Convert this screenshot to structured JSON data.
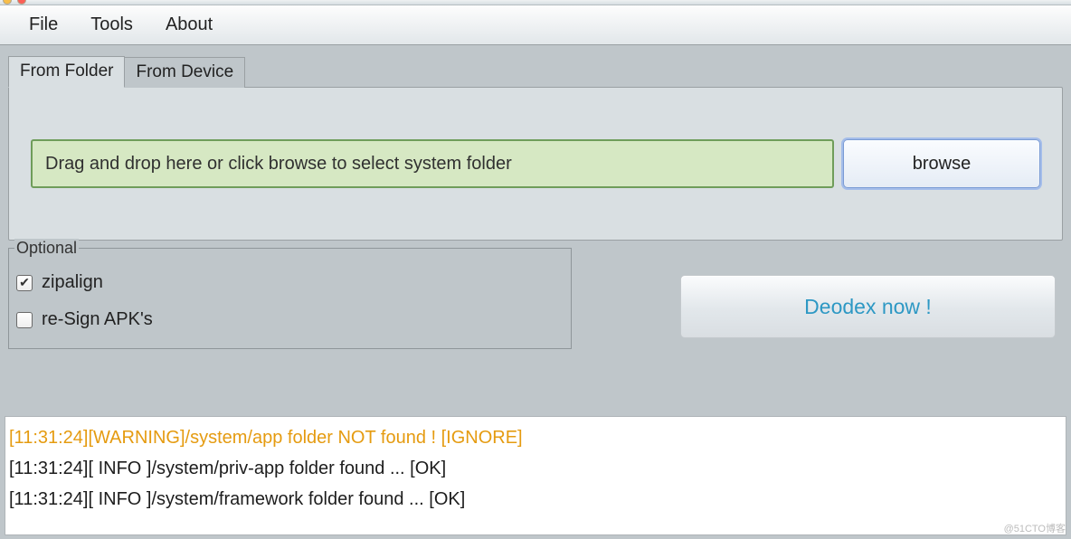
{
  "window": {
    "title_fragment": ""
  },
  "menu": {
    "file": "File",
    "tools": "Tools",
    "about": "About"
  },
  "tabs": {
    "from_folder": "From Folder",
    "from_device": "From Device",
    "active": "from_folder"
  },
  "drop": {
    "placeholder": "Drag and drop here or click browse to select system folder"
  },
  "browse": {
    "label": "browse"
  },
  "optional": {
    "legend": "Optional",
    "zipalign": {
      "label": "zipalign",
      "checked": true
    },
    "resign": {
      "label": "re-Sign APK's",
      "checked": false
    }
  },
  "deodex": {
    "label": "Deodex now !"
  },
  "log": {
    "lines": [
      {
        "ts": "11:31:24",
        "level": "WARNING",
        "msg": "/system/app folder NOT found ! [IGNORE]"
      },
      {
        "ts": "11:31:24",
        "level": "INFO",
        "msg": "/system/priv-app folder found ... [OK]"
      },
      {
        "ts": "11:31:24",
        "level": "INFO",
        "msg": "/system/framework folder found ... [OK]"
      }
    ],
    "rendered": [
      "[11:31:24][WARNING]/system/app folder NOT found ! [IGNORE]",
      "[11:31:24][ INFO  ]/system/priv-app folder found ... [OK]",
      "[11:31:24][ INFO  ]/system/framework folder found ... [OK]"
    ]
  },
  "watermark": "@51CTO博客"
}
